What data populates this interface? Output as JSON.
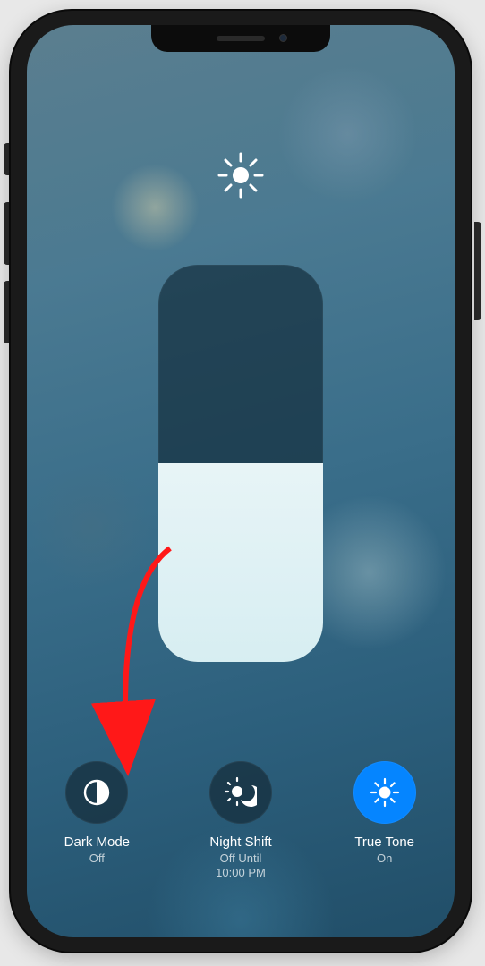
{
  "brightness": {
    "icon": "sun-icon",
    "level_percent": 50
  },
  "controls": {
    "darkMode": {
      "label": "Dark Mode",
      "status": "Off",
      "active": false
    },
    "nightShift": {
      "label": "Night Shift",
      "status": "Off Until\n10:00 PM",
      "active": false
    },
    "trueTone": {
      "label": "True Tone",
      "status": "On",
      "active": true
    }
  },
  "annotation": {
    "type": "arrow",
    "color": "#ff1a1a",
    "target": "dark-mode-button"
  }
}
